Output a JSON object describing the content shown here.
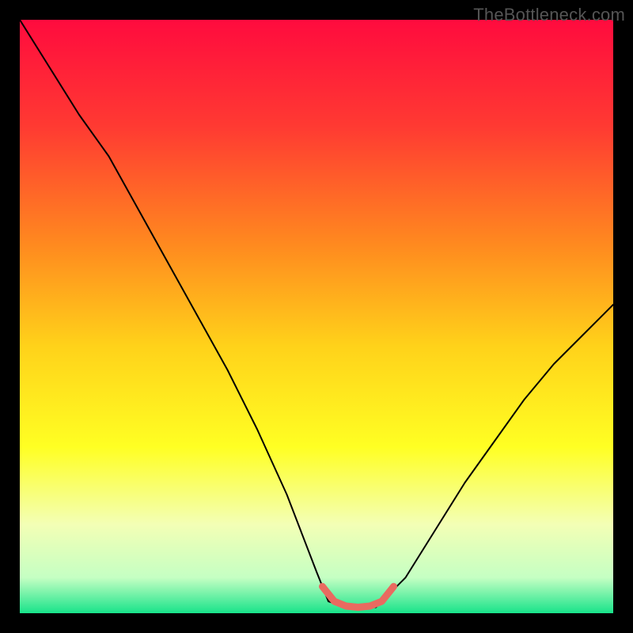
{
  "watermark": "TheBottleneck.com",
  "chart_data": {
    "type": "line",
    "title": "",
    "xlabel": "",
    "ylabel": "",
    "xlim": [
      0,
      100
    ],
    "ylim": [
      0,
      100
    ],
    "grid": false,
    "legend": false,
    "gradient_stops": [
      {
        "offset": 0.0,
        "color": "#ff0b3e"
      },
      {
        "offset": 0.18,
        "color": "#ff3a32"
      },
      {
        "offset": 0.38,
        "color": "#ff8a1f"
      },
      {
        "offset": 0.55,
        "color": "#ffd21a"
      },
      {
        "offset": 0.72,
        "color": "#ffff23"
      },
      {
        "offset": 0.85,
        "color": "#f3ffb5"
      },
      {
        "offset": 0.94,
        "color": "#c5ffc3"
      },
      {
        "offset": 1.0,
        "color": "#18e38a"
      }
    ],
    "series": [
      {
        "name": "bottleneck-curve",
        "stroke": "#000000",
        "stroke_width": 2,
        "x": [
          0,
          5,
          10,
          15,
          20,
          25,
          30,
          35,
          40,
          45,
          50,
          52,
          55,
          60,
          65,
          70,
          75,
          80,
          85,
          90,
          95,
          100
        ],
        "y": [
          100,
          92,
          84,
          77,
          68,
          59,
          50,
          41,
          31,
          20,
          7,
          2,
          1,
          1,
          6,
          14,
          22,
          29,
          36,
          42,
          47,
          52
        ]
      },
      {
        "name": "sweet-spot-band",
        "stroke": "#e96a60",
        "stroke_width": 9,
        "x": [
          51,
          53,
          55,
          57,
          59,
          61,
          63
        ],
        "y": [
          4.5,
          2.0,
          1.2,
          1.0,
          1.2,
          2.0,
          4.5
        ]
      }
    ]
  }
}
